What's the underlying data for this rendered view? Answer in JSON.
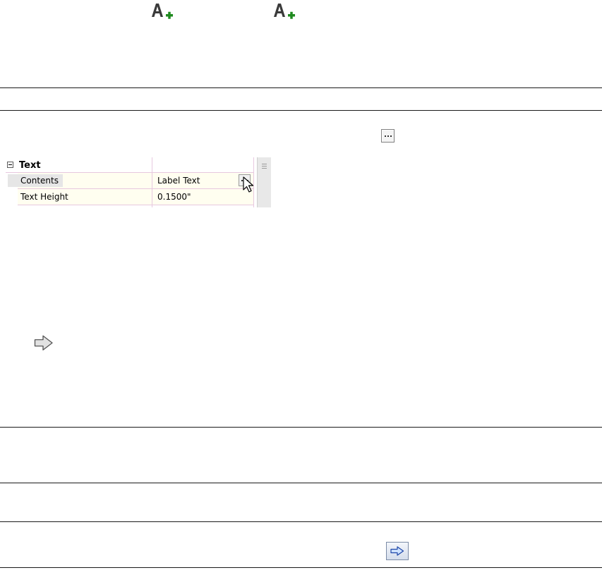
{
  "toolbar": {
    "icons": [
      "add-text-icon",
      "add-text-icon"
    ]
  },
  "property_grid": {
    "category": "Text",
    "rows": [
      {
        "name": "Contents",
        "value": "Label Text",
        "selected": true
      },
      {
        "name": "Text Height",
        "value": "0.1500\"",
        "selected": false
      }
    ]
  },
  "colors": {
    "plus_green": "#1f8a1f",
    "grid_line": "#e7c8df",
    "row_background": "#fffef0"
  }
}
